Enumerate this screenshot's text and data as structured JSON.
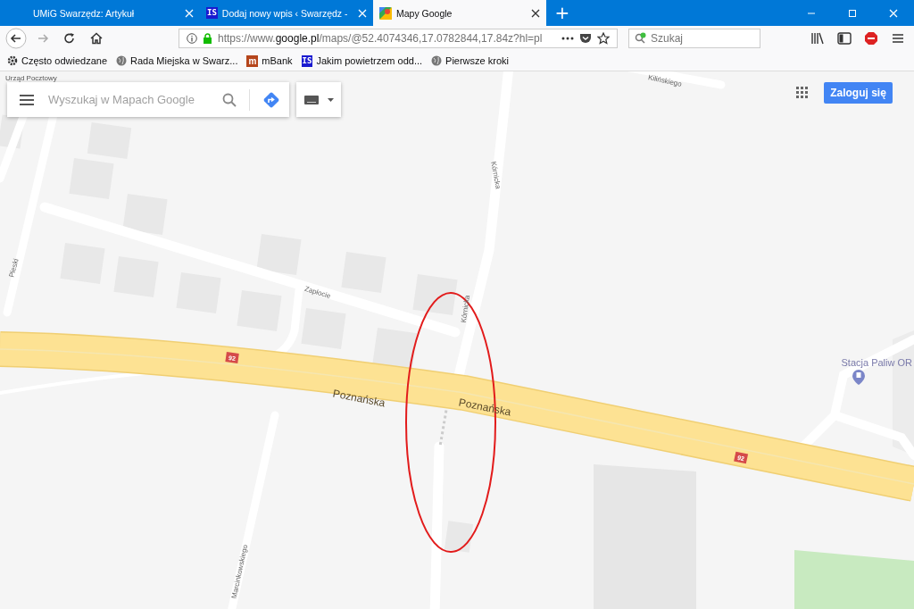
{
  "tabs": [
    {
      "title": "UMiG Swarzędz: Artykuł",
      "kind": "none",
      "selected": false
    },
    {
      "title": "Dodaj nowy wpis ‹ Swarzędz -",
      "kind": "is",
      "icon_text": "IS",
      "selected": false
    },
    {
      "title": "Mapy Google",
      "kind": "maps",
      "selected": true
    }
  ],
  "new_tab": "+",
  "toolbar": {
    "url": "https://www.**google.pl**/maps/@52.4074346,17.0782844,17.84z?hl=pl",
    "search_placeholder": "Szukaj"
  },
  "bookmarks": [
    {
      "label": "Często odwiedzane",
      "kind": "gear"
    },
    {
      "label": "Rada Miejska w Swarz...",
      "kind": "globe"
    },
    {
      "label": "mBank",
      "kind": "mbank",
      "icon_text": "m"
    },
    {
      "label": "Jakim powietrzem odd...",
      "kind": "is",
      "icon_text": "IS"
    },
    {
      "label": "Pierwsze kroki",
      "kind": "globe"
    }
  ],
  "map": {
    "search_placeholder": "Wyszukaj w Mapach Google",
    "login_button": "Zaloguj się",
    "labels": [
      {
        "text": "Urząd Pocztowy",
        "kind": "poi-top"
      },
      {
        "text": "Kilińskiego",
        "kind": "street"
      },
      {
        "text": "Kórnicka",
        "kind": "street"
      },
      {
        "text": "Pieski",
        "kind": "street"
      },
      {
        "text": "Zapłocie",
        "kind": "street"
      },
      {
        "text": "Kórnicka",
        "kind": "street"
      },
      {
        "text": "92",
        "kind": "shield"
      },
      {
        "text": "Poznańska",
        "kind": "major"
      },
      {
        "text": "Poznańska",
        "kind": "major"
      },
      {
        "text": "Stacja Paliw OR",
        "kind": "poi"
      },
      {
        "text": "92",
        "kind": "shield"
      },
      {
        "text": "Marcinkowskiego",
        "kind": "street"
      }
    ]
  }
}
